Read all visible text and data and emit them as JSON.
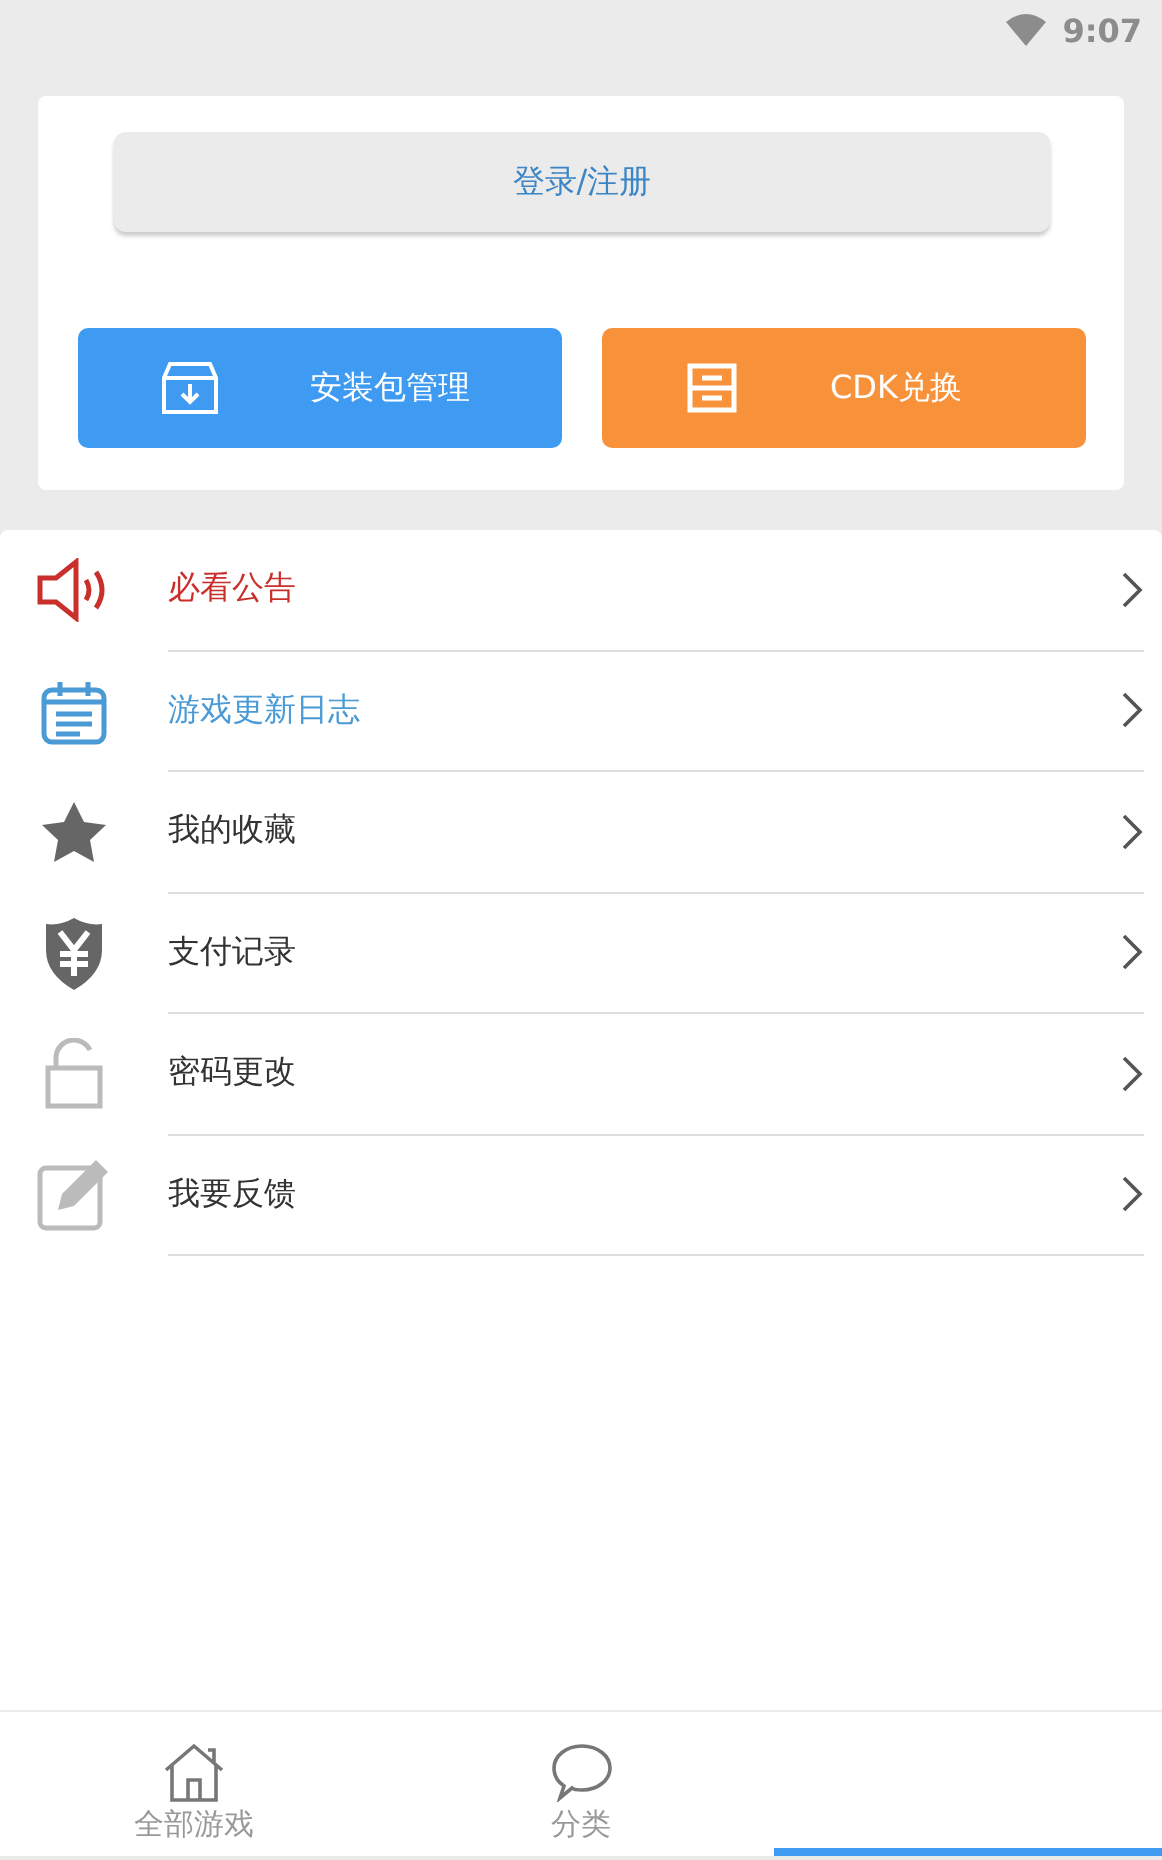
{
  "status_bar": {
    "time": "9:07"
  },
  "account_card": {
    "login_button": "登录/注册",
    "actions": [
      {
        "label": "安装包管理",
        "kind": "package",
        "color": "#3f9bf2"
      },
      {
        "label": "CDK兑换",
        "kind": "drawer",
        "color": "#f7923a"
      }
    ]
  },
  "menu": [
    {
      "label": "必看公告",
      "kind": "speaker",
      "color": "#c9302c"
    },
    {
      "label": "游戏更新日志",
      "kind": "calendar",
      "color": "#4a9ad6"
    },
    {
      "label": "我的收藏",
      "kind": "star",
      "color": "#333333"
    },
    {
      "label": "支付记录",
      "kind": "shield",
      "color": "#333333"
    },
    {
      "label": "密码更改",
      "kind": "lock",
      "color": "#333333"
    },
    {
      "label": "我要反馈",
      "kind": "edit",
      "color": "#333333"
    }
  ],
  "bottom_nav": [
    {
      "label": "全部游戏",
      "kind": "home",
      "selected": false
    },
    {
      "label": "分类",
      "kind": "chat",
      "selected": false
    },
    {
      "kind": "indicator",
      "selected": true
    }
  ]
}
